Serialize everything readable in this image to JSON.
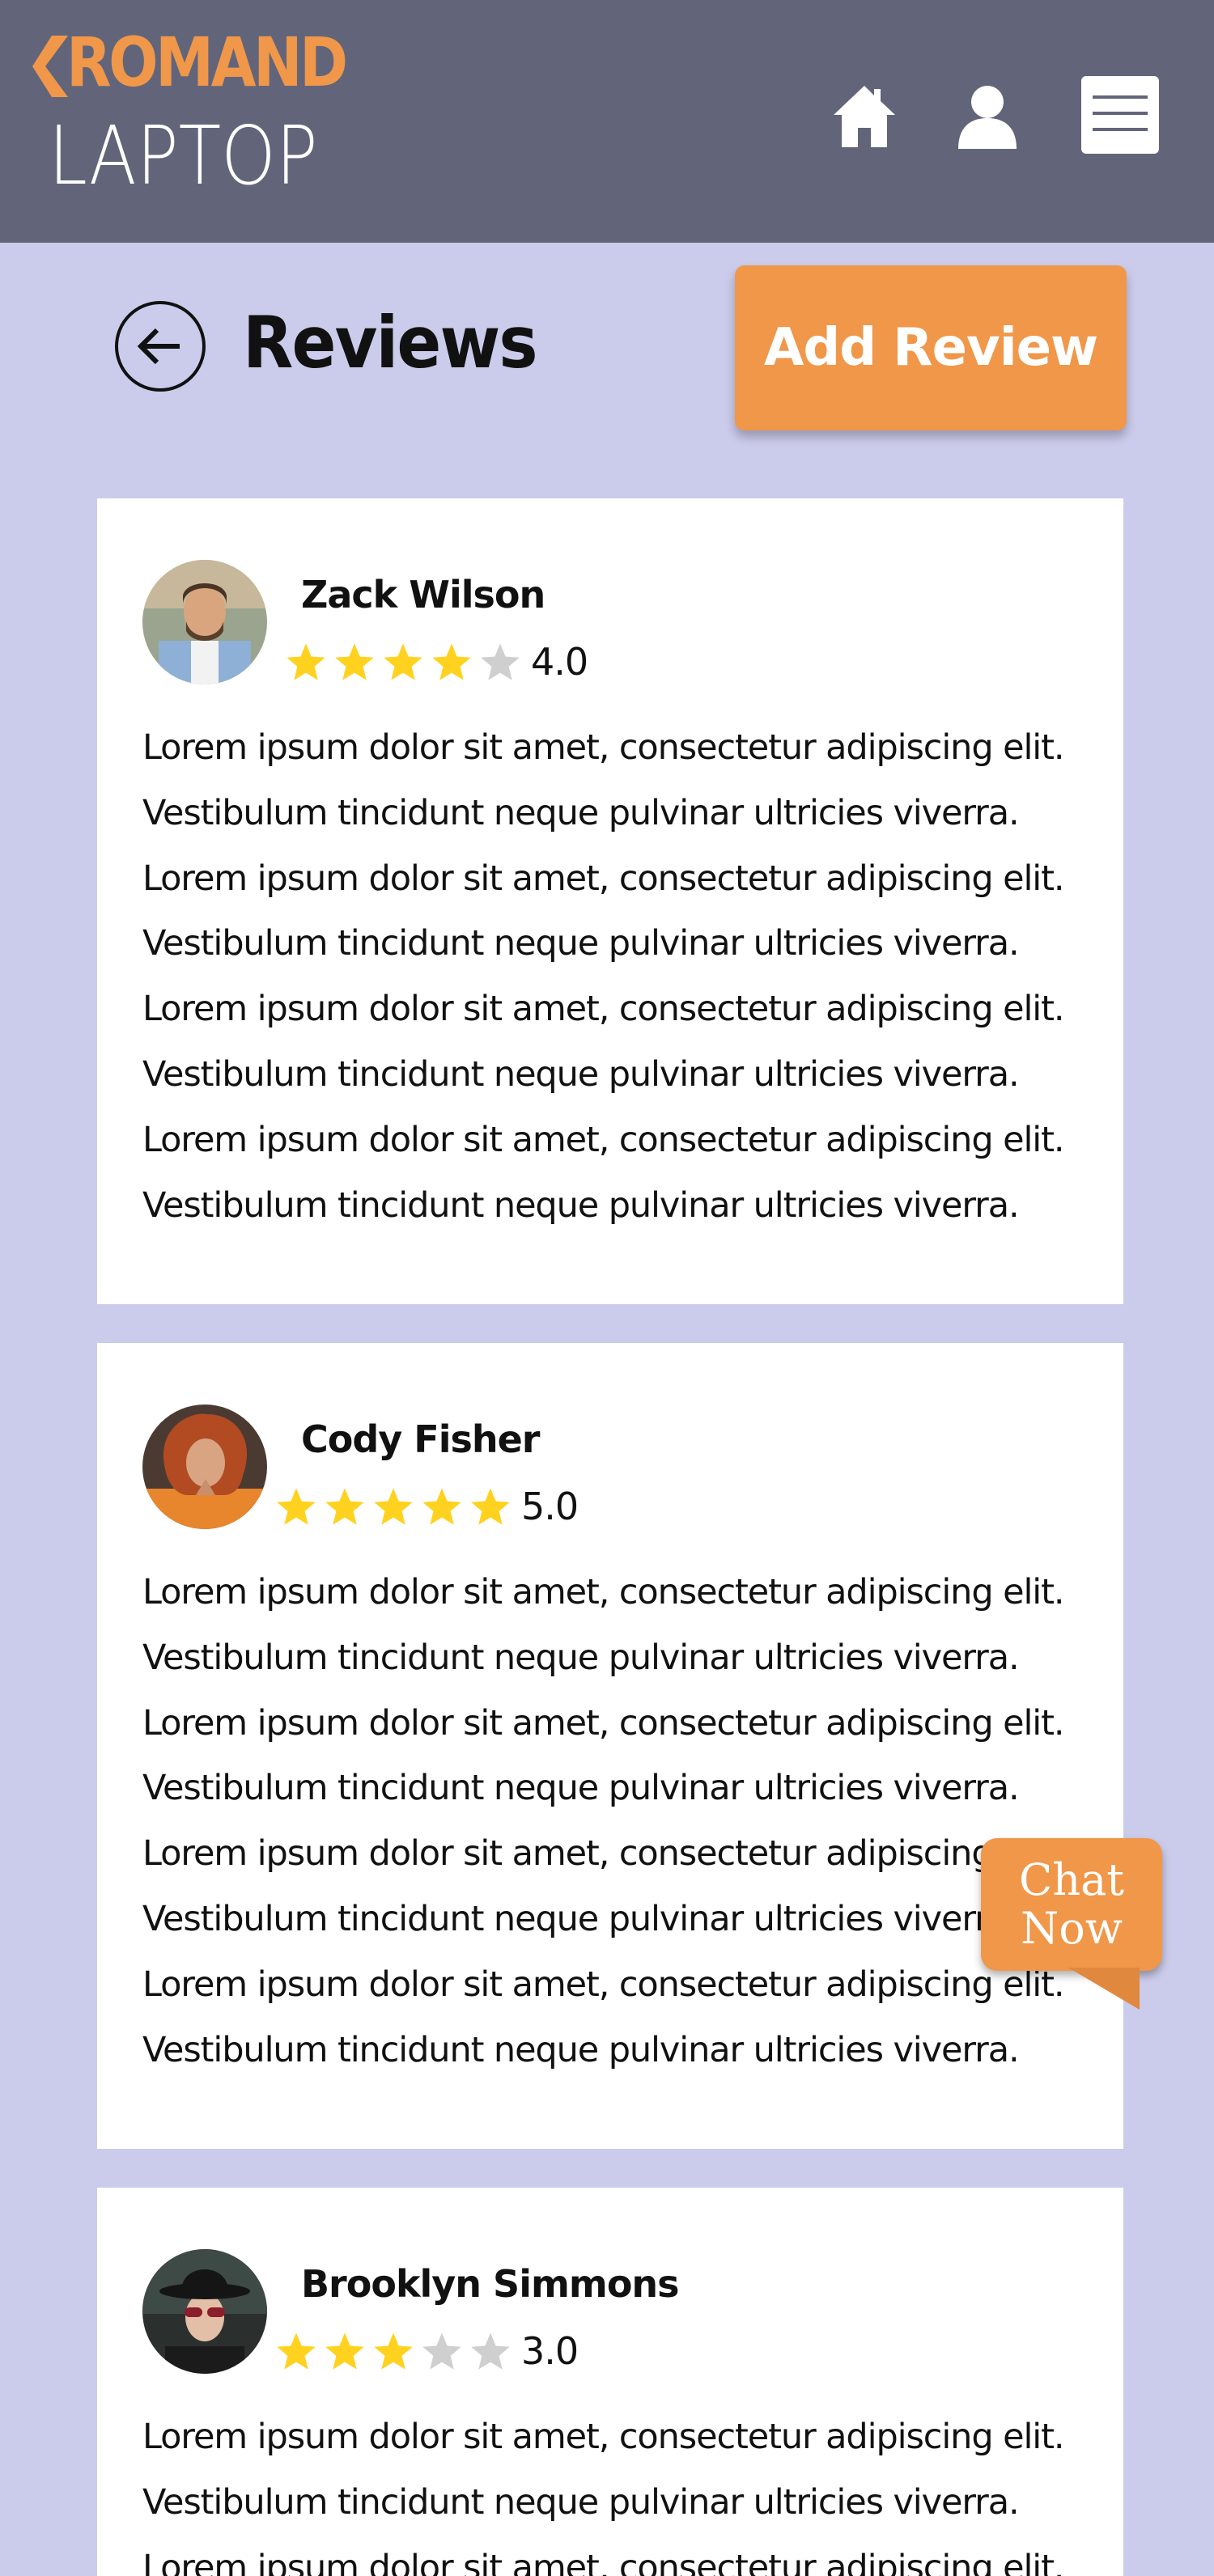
{
  "header": {
    "brand": "ROMAND",
    "brand_sub": "LAPTOP",
    "colors": {
      "bar": "#62657A",
      "accent": "#F0974A"
    },
    "icons": [
      "home-icon",
      "user-icon",
      "hamburger-menu-icon"
    ]
  },
  "page": {
    "title": "Reviews",
    "add_button": "Add Review",
    "back_icon": "arrow-left-icon",
    "background": "#CBCBEB"
  },
  "reviews": [
    {
      "name": "Zack Wilson",
      "rating": 4,
      "rating_label": "4.0",
      "lines": [
        "Lorem ipsum dolor sit amet, consectetur adipiscing elit.",
        "Vestibulum tincidunt neque pulvinar ultricies viverra.",
        "Lorem ipsum dolor sit amet, consectetur adipiscing elit.",
        "Vestibulum tincidunt neque pulvinar ultricies viverra.",
        "Lorem ipsum dolor sit amet, consectetur adipiscing elit.",
        "Vestibulum tincidunt neque pulvinar ultricies viverra.",
        "Lorem ipsum dolor sit amet, consectetur adipiscing elit.",
        "Vestibulum tincidunt neque pulvinar ultricies viverra."
      ]
    },
    {
      "name": "Cody Fisher",
      "rating": 5,
      "rating_label": "5.0",
      "lines": [
        "Lorem ipsum dolor sit amet, consectetur adipiscing elit.",
        "Vestibulum tincidunt neque pulvinar ultricies viverra.",
        "Lorem ipsum dolor sit amet, consectetur adipiscing elit.",
        "Vestibulum tincidunt neque pulvinar ultricies viverra.",
        "Lorem ipsum dolor sit amet, consectetur adipiscing elit.",
        "Vestibulum tincidunt neque pulvinar ultricies viverra.",
        "Lorem ipsum dolor sit amet, consectetur adipiscing elit.",
        "Vestibulum tincidunt neque pulvinar ultricies viverra."
      ]
    },
    {
      "name": "Brooklyn Simmons",
      "rating": 3,
      "rating_label": "3.0",
      "lines": [
        "Lorem ipsum dolor sit amet, consectetur adipiscing elit.",
        "Vestibulum tincidunt neque pulvinar ultricies viverra.",
        "Lorem ipsum dolor sit amet, consectetur adipiscing elit."
      ]
    }
  ],
  "chat": {
    "line1": "Chat",
    "line2": "Now"
  }
}
